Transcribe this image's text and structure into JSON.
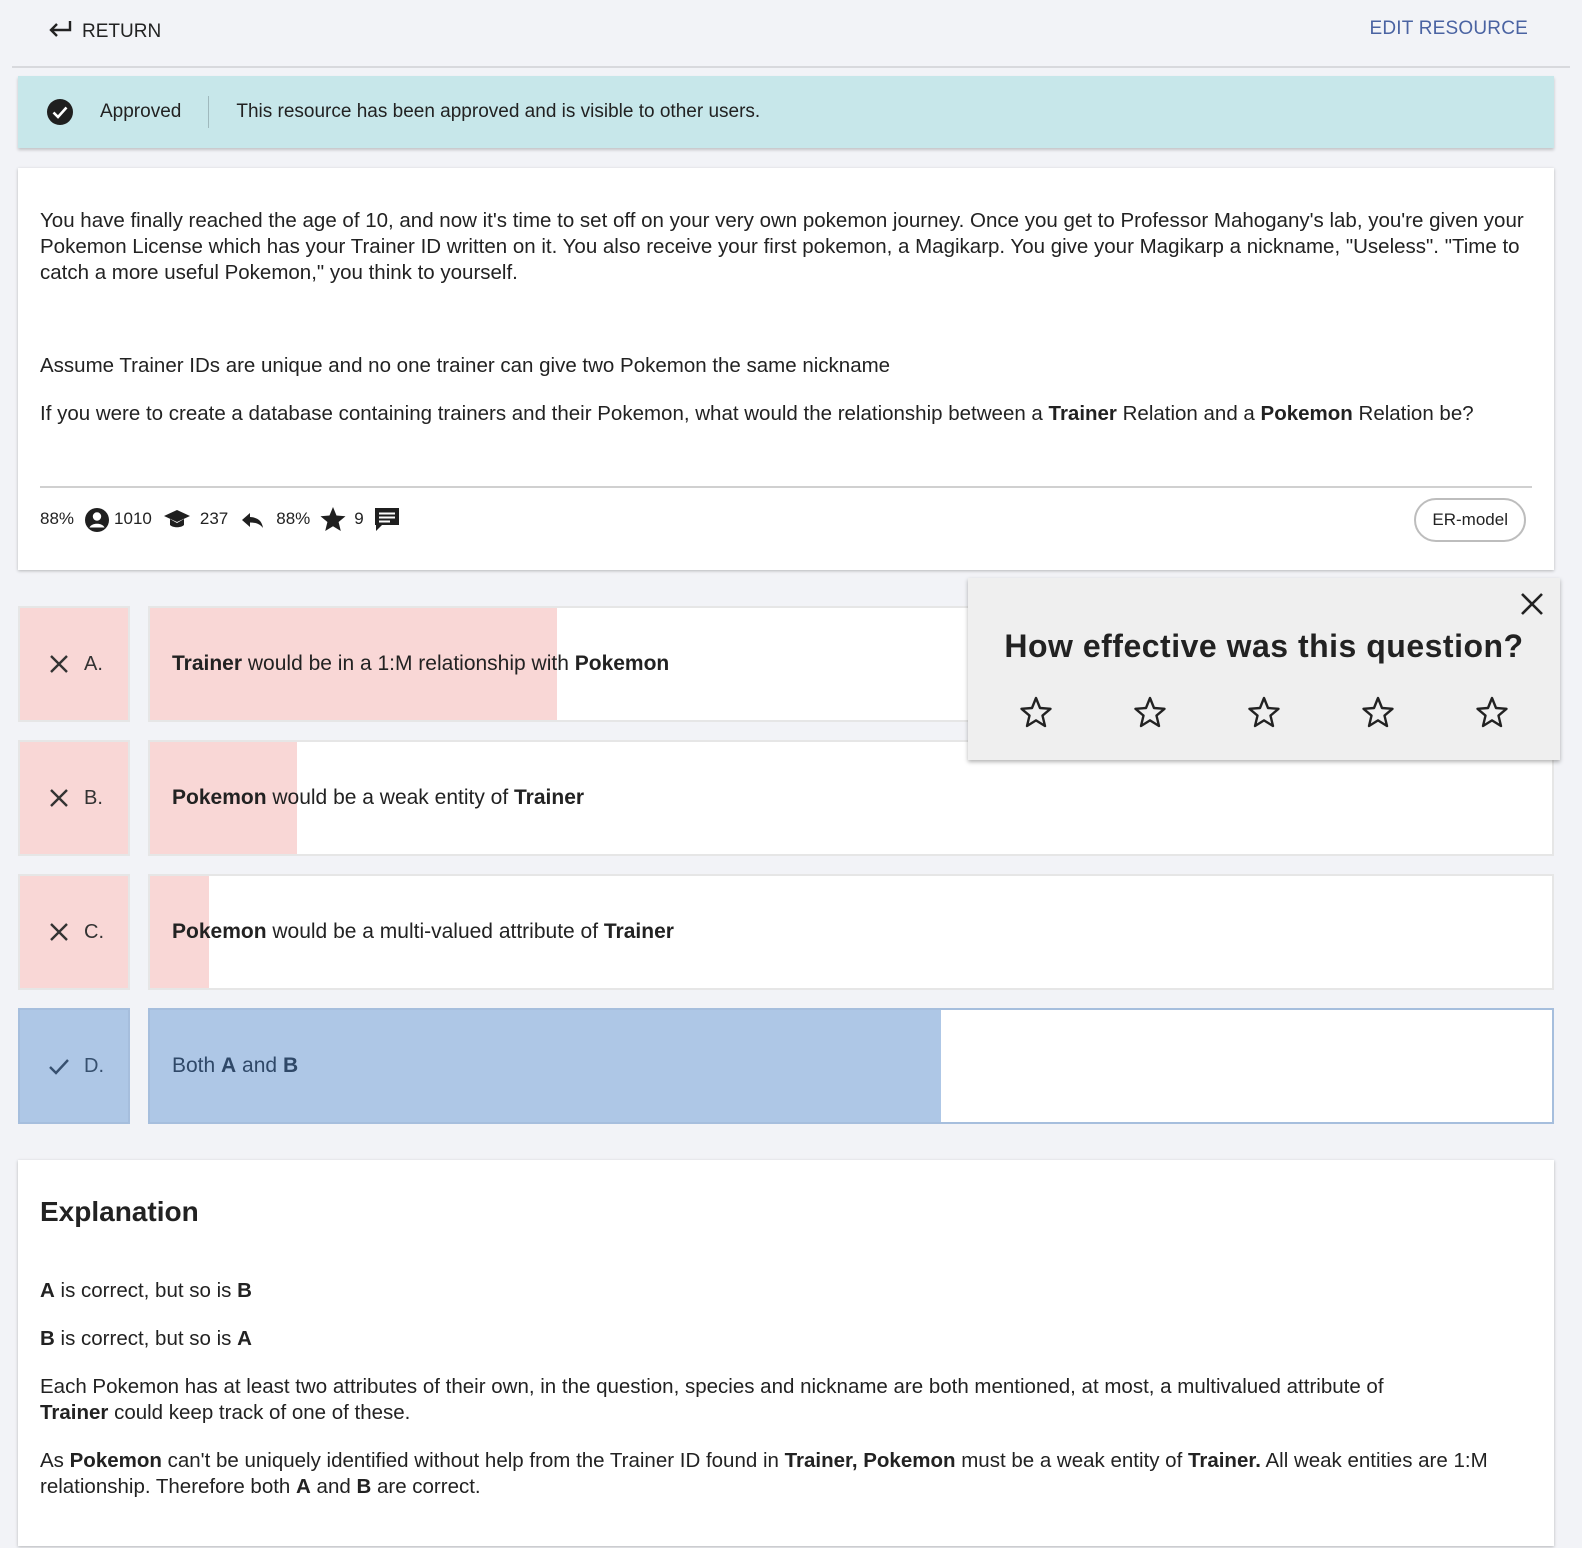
{
  "topbar": {
    "return_label": "RETURN",
    "edit_label": "EDIT RESOURCE"
  },
  "banner": {
    "status": "Approved",
    "message": "This resource has been approved and is visible to other users."
  },
  "question": {
    "p1": "You have finally reached the age of 10, and now it's time to set off on your very own pokemon journey. Once you get to Professor Mahogany's lab, you're given your Pokemon License which has your Trainer ID written on it. You also receive your first pokemon, a Magikarp. You give your Magikarp a nickname, \"Useless\". \"Time to catch a more useful Pokemon,\" you think to yourself.",
    "p2": "Assume Trainer IDs are unique and no one trainer can give two Pokemon the same nickname",
    "p3_a": "If you were to create a database containing trainers and their Pokemon, what would the relationship between a ",
    "p3_b": "Trainer",
    "p3_c": " Relation and a ",
    "p3_d": "Pokemon",
    "p3_e": " Relation be?"
  },
  "stats": {
    "pct1": "88%",
    "users": "1010",
    "grad": "237",
    "pct2": "88%",
    "stars": "9",
    "icons": [
      "account-icon",
      "graduation-cap-icon",
      "reply-icon",
      "star-icon",
      "comment-icon"
    ]
  },
  "tag": "ER-model",
  "options": [
    {
      "letter": "A.",
      "status": "wrong",
      "fraction": 0.29,
      "t1": "Trainer",
      "t2": " would be in a 1:M relationship with ",
      "t3": "Pokemon",
      "t4": "",
      "t5": ""
    },
    {
      "letter": "B.",
      "status": "wrong",
      "fraction": 0.105,
      "t1": "Pokemon",
      "t2": " would be a weak entity of ",
      "t3": "Trainer",
      "t4": "",
      "t5": ""
    },
    {
      "letter": "C.",
      "status": "wrong",
      "fraction": 0.042,
      "t1": "Pokemon",
      "t2": " would be a multi-valued attribute of ",
      "t3": "Trainer",
      "t4": "",
      "t5": ""
    },
    {
      "letter": "D.",
      "status": "correct",
      "fraction": 0.564,
      "t0": "Both ",
      "t1": "A",
      "t2": " and ",
      "t3": "B"
    }
  ],
  "rating": {
    "title": "How effective was this question?",
    "star_count": 5
  },
  "explanation": {
    "heading": "Explanation",
    "l1_a": "A",
    "l1_b": " is correct, but so is ",
    "l1_c": "B",
    "l2_a": "B",
    "l2_b": " is correct, but so is ",
    "l2_c": "A",
    "l3_a": "Each Pokemon has at least two attributes of their own, in the question, species and nickname are both mentioned, at most, a multivalued attribute of ",
    "l3_b": "Trainer",
    "l3_c": " could keep track of one of these.",
    "l4_a": "As ",
    "l4_b": "Pokemon",
    "l4_c": " can't be uniquely identified without help from the Trainer ID found in ",
    "l4_d": "Trainer, Pokemon",
    "l4_e": " must be a weak entity of ",
    "l4_f": "Trainer.",
    "l4_g": " All weak entities are 1:M relationship. Therefore both ",
    "l4_h": "A",
    "l4_i": " and ",
    "l4_j": "B",
    "l4_k": " are correct."
  }
}
